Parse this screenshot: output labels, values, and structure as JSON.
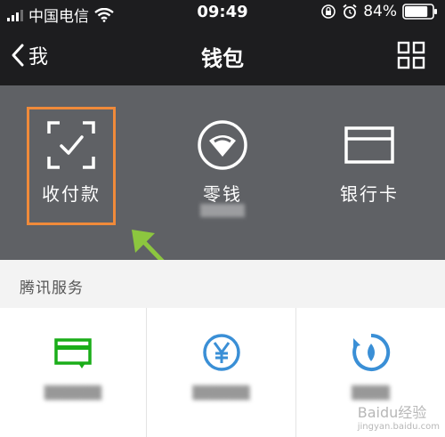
{
  "status_bar": {
    "carrier": "中国电信",
    "time": "09:49",
    "battery": "84%",
    "signal_icon": "signal-bars-icon",
    "wifi_icon": "wifi-icon",
    "rotation_lock_icon": "rotation-lock-icon",
    "alarm_icon": "alarm-icon",
    "battery_icon": "battery-icon",
    "battery_level": 0.84
  },
  "nav": {
    "back_label": "我",
    "title": "钱包",
    "more_icon": "grid-icon"
  },
  "wallet": {
    "items": [
      {
        "label": "收付款",
        "icon": "scan-pay-icon",
        "sublabel": ""
      },
      {
        "label": "零钱",
        "icon": "change-icon",
        "sublabel": "▒▒▒▒▒"
      },
      {
        "label": "银行卡",
        "icon": "bank-card-icon",
        "sublabel": ""
      }
    ]
  },
  "services": {
    "title": "腾讯服务",
    "items": [
      {
        "icon": "credit-card-repay-icon",
        "label": "▒▒▒▒▒▒",
        "color": "#1aad19"
      },
      {
        "icon": "yuan-coin-icon",
        "label": "▒▒▒▒▒▒",
        "color": "#3a8fd6"
      },
      {
        "icon": "phone-topup-icon",
        "label": "▒▒▒▒",
        "color": "#3a8fd6"
      }
    ]
  },
  "watermark": {
    "text": "Baidu经验",
    "sub": "jingyan.baidu.com"
  },
  "colors": {
    "nav_bg": "#1d1d1f",
    "panel_bg": "#5f6165",
    "highlight": "#f08a3a",
    "arrow": "#8cc63f"
  }
}
